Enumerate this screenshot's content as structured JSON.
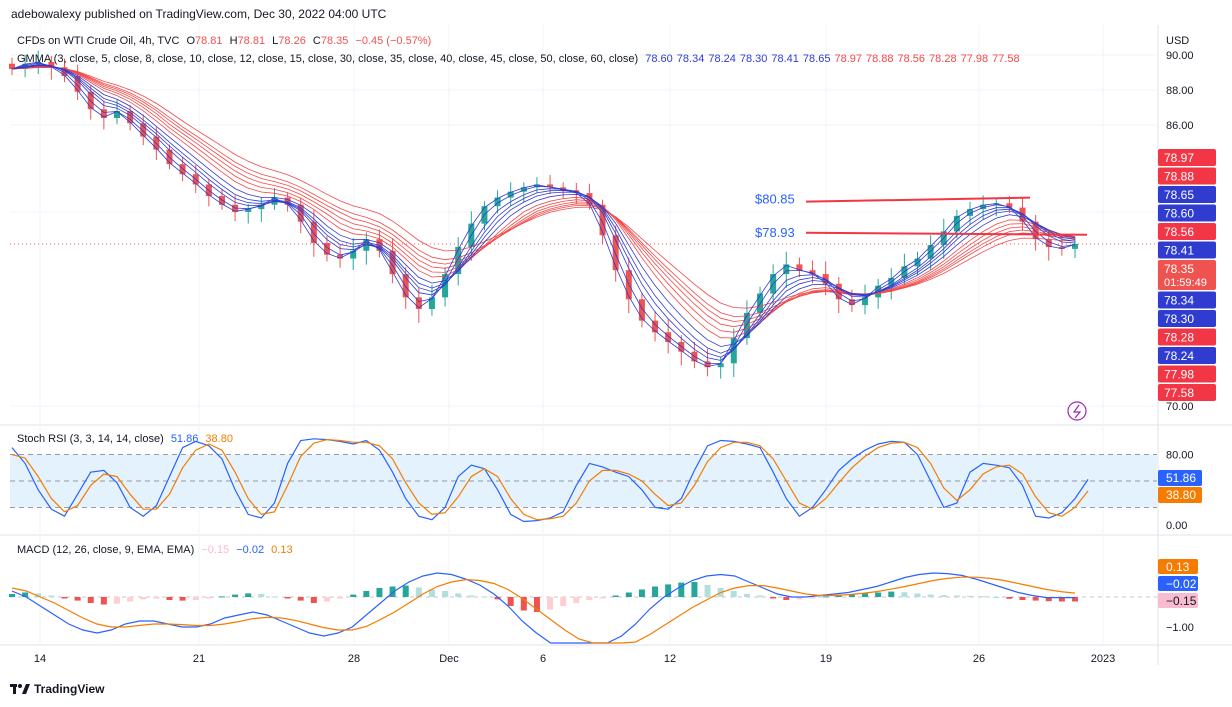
{
  "header": {
    "publisher_text": "adebowalexy published on TradingView.com, Dec 30, 2022 04:00 UTC"
  },
  "footer": {
    "brand": "TradingView",
    "logo_icon": "tradingview-logo-icon"
  },
  "price_pane": {
    "instrument_prefix": "CFDs on WTI Crude Oil, 4h, TVC",
    "open_label": "O",
    "open": "78.81",
    "high_label": "H",
    "high": "78.81",
    "low_label": "L",
    "low": "78.26",
    "close_label": "C",
    "close": "78.35",
    "change": "−0.45 (−0.57%)",
    "gmma_label": "GMMA (3, close, 5, close, 8, close, 10, close, 12, close, 15, close, 30, close, 35, close, 40, close, 45, close, 50, close, 60, close)",
    "gmma_values": [
      "78.60",
      "78.34",
      "78.24",
      "78.30",
      "78.41",
      "78.65",
      "78.97",
      "78.88",
      "78.56",
      "78.28",
      "77.98",
      "77.58"
    ],
    "currency": "USD",
    "countdown": "01:59:49"
  },
  "stoch_pane": {
    "label": "Stoch RSI (3, 3, 14, 14, close)",
    "k": "51.86",
    "d": "38.80"
  },
  "macd_pane": {
    "label": "MACD (12, 26, close, 9, EMA, EMA)",
    "hist": "−0.15",
    "macd": "−0.02",
    "signal": "0.13"
  },
  "colors": {
    "up": "#26a69a",
    "down": "#ef5350",
    "short_ema": "#2f3ccf",
    "long_ema": "#f24848",
    "stoch_k": "#2962ff",
    "stoch_d": "#f57c00",
    "macd": "#2962ff",
    "signal": "#f57c00",
    "annotation": "#2962ff",
    "trendline": "#f23645",
    "bg_band": "#e3f2fd"
  },
  "chart_data": [
    {
      "type": "candlestick",
      "title": "CFDs on WTI Crude Oil, 4h, TVC",
      "ylabel": "USD",
      "y_ticks": [
        "90.00",
        "88.00",
        "86.00",
        "80.00",
        "70.00"
      ],
      "x_ticks": [
        "14",
        "21",
        "28",
        "Dec",
        "6",
        "12",
        "19",
        "26",
        "2023"
      ],
      "last_price": 78.35,
      "price_axis_labels": [
        {
          "value": "78.97",
          "color": "#f23645"
        },
        {
          "value": "78.88",
          "color": "#f23645"
        },
        {
          "value": "78.65",
          "color": "#2f3ccf"
        },
        {
          "value": "78.60",
          "color": "#2f3ccf"
        },
        {
          "value": "78.56",
          "color": "#f23645"
        },
        {
          "value": "78.41",
          "color": "#2f3ccf"
        },
        {
          "value": "78.35",
          "color": "#ef5350"
        },
        {
          "value": "78.34",
          "color": "#2f3ccf"
        },
        {
          "value": "78.30",
          "color": "#2f3ccf"
        },
        {
          "value": "78.28",
          "color": "#f23645"
        },
        {
          "value": "78.24",
          "color": "#2f3ccf"
        },
        {
          "value": "77.98",
          "color": "#f23645"
        },
        {
          "value": "77.58",
          "color": "#f23645"
        }
      ],
      "close_series": [
        89.2,
        89.5,
        89.6,
        89.3,
        88.8,
        87.9,
        86.9,
        86.4,
        86.8,
        86.1,
        85.2,
        84.3,
        83.3,
        82.6,
        81.9,
        81.1,
        80.5,
        80.0,
        80.2,
        80.5,
        81.0,
        80.5,
        79.5,
        78.4,
        77.8,
        77.6,
        78.0,
        78.6,
        78.0,
        76.8,
        75.6,
        75.0,
        75.6,
        76.8,
        78.2,
        79.4,
        80.4,
        81.0,
        81.4,
        81.7,
        81.9,
        81.7,
        81.5,
        81.3,
        80.5,
        78.8,
        77.0,
        75.5,
        74.4,
        73.8,
        73.3,
        72.8,
        72.3,
        72.0,
        72.2,
        73.5,
        74.8,
        75.8,
        76.8,
        77.3,
        77.0,
        76.8,
        76.3,
        75.5,
        75.2,
        75.6,
        76.2,
        76.6,
        77.2,
        77.6,
        78.3,
        79.0,
        79.8,
        80.2,
        80.5,
        80.6,
        80.3,
        79.5,
        78.6,
        78.2,
        78.1,
        78.35
      ],
      "annotations": [
        {
          "label": "$80.85",
          "value": 80.85
        },
        {
          "label": "$78.93",
          "value": 78.93
        }
      ],
      "gmma": {
        "short_periods": [
          3,
          5,
          8,
          10,
          12,
          15
        ],
        "long_periods": [
          30,
          35,
          40,
          45,
          50,
          60
        ]
      }
    },
    {
      "type": "line",
      "title": "Stoch RSI (3, 3, 14, 14, close)",
      "y_ticks": [
        "80.00",
        "0.00"
      ],
      "ylim": [
        0,
        100
      ],
      "band": [
        20,
        80
      ],
      "series": [
        {
          "name": "K",
          "last": 51.86,
          "values": [
            88,
            70,
            40,
            18,
            10,
            35,
            60,
            62,
            48,
            20,
            10,
            22,
            55,
            88,
            95,
            90,
            75,
            40,
            12,
            8,
            25,
            70,
            96,
            98,
            97,
            95,
            92,
            96,
            85,
            60,
            30,
            10,
            6,
            20,
            55,
            68,
            64,
            40,
            12,
            4,
            5,
            8,
            15,
            45,
            70,
            66,
            60,
            55,
            40,
            20,
            18,
            30,
            62,
            90,
            96,
            95,
            92,
            88,
            60,
            30,
            10,
            20,
            40,
            62,
            75,
            85,
            92,
            95,
            94,
            80,
            50,
            20,
            25,
            60,
            70,
            68,
            65,
            45,
            10,
            8,
            14,
            30,
            51.86
          ]
        },
        {
          "name": "D",
          "last": 38.8,
          "values": [
            80,
            76,
            55,
            30,
            15,
            22,
            45,
            58,
            55,
            35,
            18,
            18,
            35,
            65,
            85,
            92,
            85,
            60,
            30,
            12,
            15,
            45,
            78,
            93,
            97,
            96,
            94,
            94,
            90,
            75,
            48,
            25,
            12,
            14,
            32,
            55,
            64,
            55,
            30,
            12,
            6,
            7,
            10,
            25,
            50,
            62,
            62,
            58,
            50,
            35,
            22,
            25,
            45,
            72,
            88,
            94,
            94,
            90,
            75,
            50,
            25,
            18,
            30,
            48,
            65,
            78,
            88,
            93,
            94,
            88,
            70,
            42,
            28,
            40,
            58,
            66,
            68,
            58,
            32,
            14,
            10,
            20,
            38.8
          ]
        }
      ]
    },
    {
      "type": "bar",
      "title": "MACD (12, 26, close, 9, EMA, EMA)",
      "y_ticks": [
        "-1.00"
      ],
      "histogram": [
        0.1,
        0.15,
        0.12,
        0.05,
        -0.05,
        -0.12,
        -0.2,
        -0.25,
        -0.22,
        -0.15,
        -0.08,
        -0.05,
        -0.1,
        -0.12,
        -0.1,
        -0.05,
        0.02,
        0.08,
        0.12,
        0.1,
        0.02,
        -0.05,
        -0.12,
        -0.2,
        -0.15,
        -0.05,
        0.08,
        0.2,
        0.3,
        0.35,
        0.38,
        0.32,
        0.25,
        0.2,
        0.12,
        0.05,
        0.02,
        -0.08,
        -0.3,
        -0.45,
        -0.5,
        -0.42,
        -0.3,
        -0.2,
        -0.1,
        -0.05,
        0.05,
        0.15,
        0.25,
        0.35,
        0.42,
        0.48,
        0.5,
        0.4,
        0.3,
        0.2,
        0.1,
        0.05,
        -0.05,
        -0.1,
        -0.08,
        -0.05,
        0.02,
        0.06,
        0.1,
        0.12,
        0.15,
        0.18,
        0.16,
        0.12,
        0.08,
        0.06,
        0.05,
        0.04,
        0.03,
        0.0,
        -0.06,
        -0.1,
        -0.12,
        -0.14,
        -0.15,
        -0.15
      ],
      "series": [
        {
          "name": "MACD",
          "last": -0.02,
          "values": [
            0.2,
            0.0,
            -0.3,
            -0.6,
            -0.9,
            -1.1,
            -1.2,
            -1.1,
            -0.9,
            -0.8,
            -0.8,
            -0.9,
            -1.0,
            -1.0,
            -0.9,
            -0.7,
            -0.6,
            -0.5,
            -0.6,
            -0.8,
            -1.0,
            -1.2,
            -1.3,
            -1.2,
            -1.0,
            -0.6,
            -0.2,
            0.2,
            0.5,
            0.7,
            0.8,
            0.75,
            0.6,
            0.4,
            0.1,
            -0.3,
            -0.8,
            -1.2,
            -1.6,
            -1.9,
            -2.1,
            -2.0,
            -1.7,
            -1.3,
            -0.9,
            -0.4,
            0.0,
            0.3,
            0.55,
            0.7,
            0.75,
            0.7,
            0.5,
            0.3,
            0.1,
            0.0,
            0.0,
            0.05,
            0.1,
            0.15,
            0.25,
            0.35,
            0.5,
            0.65,
            0.75,
            0.8,
            0.78,
            0.72,
            0.6,
            0.45,
            0.3,
            0.15,
            0.05,
            -0.02,
            -0.02,
            -0.02
          ]
        },
        {
          "name": "Signal",
          "last": 0.13,
          "values": [
            0.3,
            0.2,
            0.0,
            -0.2,
            -0.45,
            -0.7,
            -0.9,
            -1.0,
            -1.0,
            -0.95,
            -0.9,
            -0.9,
            -0.92,
            -0.95,
            -0.95,
            -0.9,
            -0.82,
            -0.72,
            -0.68,
            -0.7,
            -0.78,
            -0.9,
            -1.02,
            -1.1,
            -1.1,
            -0.98,
            -0.75,
            -0.5,
            -0.2,
            0.1,
            0.35,
            0.5,
            0.58,
            0.55,
            0.45,
            0.25,
            -0.05,
            -0.4,
            -0.75,
            -1.1,
            -1.4,
            -1.6,
            -1.7,
            -1.65,
            -1.5,
            -1.25,
            -0.95,
            -0.65,
            -0.35,
            -0.1,
            0.15,
            0.3,
            0.38,
            0.38,
            0.3,
            0.2,
            0.1,
            0.05,
            0.05,
            0.08,
            0.12,
            0.18,
            0.26,
            0.35,
            0.45,
            0.55,
            0.62,
            0.66,
            0.66,
            0.62,
            0.55,
            0.45,
            0.35,
            0.25,
            0.18,
            0.13
          ]
        }
      ]
    }
  ]
}
